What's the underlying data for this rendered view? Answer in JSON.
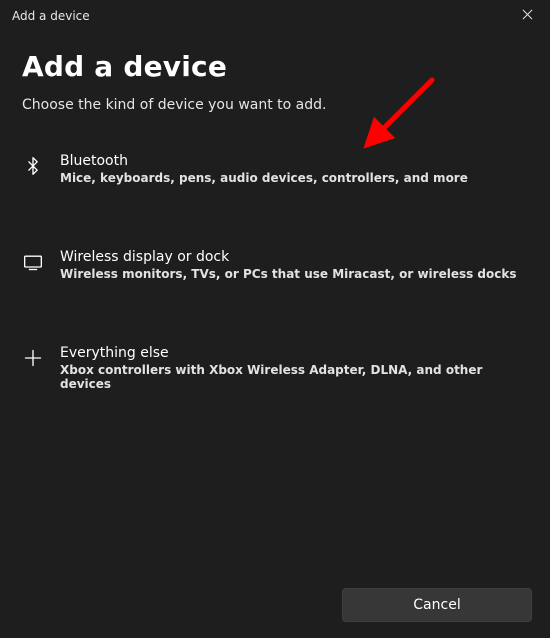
{
  "titlebar": {
    "title": "Add a device"
  },
  "header": {
    "title": "Add a device",
    "subtitle": "Choose the kind of device you want to add."
  },
  "options": [
    {
      "icon": "bluetooth-icon",
      "title": "Bluetooth",
      "desc": "Mice, keyboards, pens, audio devices, controllers, and more"
    },
    {
      "icon": "monitor-icon",
      "title": "Wireless display or dock",
      "desc": "Wireless monitors, TVs, or PCs that use Miracast, or wireless docks"
    },
    {
      "icon": "plus-icon",
      "title": "Everything else",
      "desc": "Xbox controllers with Xbox Wireless Adapter, DLNA, and other devices"
    }
  ],
  "footer": {
    "cancel_label": "Cancel"
  }
}
